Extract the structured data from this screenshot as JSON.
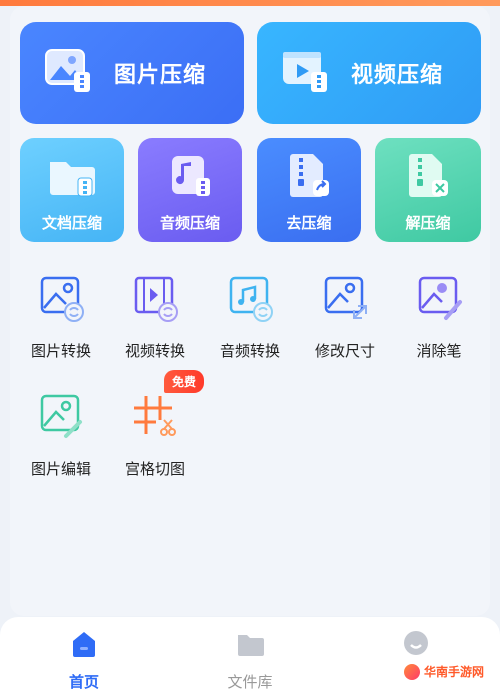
{
  "featured": {
    "image_compress": {
      "label": "图片压缩",
      "icon": "image-compress-icon"
    },
    "video_compress": {
      "label": "视频压缩",
      "icon": "video-compress-icon"
    }
  },
  "compress_tools": [
    {
      "label": "文档压缩",
      "icon": "folder-zip-icon"
    },
    {
      "label": "音频压缩",
      "icon": "music-zip-icon"
    },
    {
      "label": "去压缩",
      "icon": "zip-extract-icon"
    },
    {
      "label": "解压缩",
      "icon": "zip-unpack-icon"
    }
  ],
  "tools": [
    {
      "label": "图片转换",
      "icon": "image-convert-icon"
    },
    {
      "label": "视频转换",
      "icon": "video-convert-icon"
    },
    {
      "label": "音频转换",
      "icon": "audio-convert-icon"
    },
    {
      "label": "修改尺寸",
      "icon": "resize-icon"
    },
    {
      "label": "消除笔",
      "icon": "eraser-brush-icon"
    },
    {
      "label": "图片编辑",
      "icon": "image-edit-icon"
    },
    {
      "label": "宫格切图",
      "icon": "grid-cut-icon"
    }
  ],
  "badge": {
    "label": "免费"
  },
  "bottom_nav": [
    {
      "label": "首页",
      "active": true,
      "icon": "home-icon"
    },
    {
      "label": "文件库",
      "active": false,
      "icon": "folder-icon"
    },
    {
      "label": "我的",
      "active": false,
      "icon": "profile-icon"
    }
  ],
  "watermark": {
    "text": "华南手游网"
  },
  "colors": {
    "primary": "#2f6cf6",
    "tool_icon": "#3a6ef0",
    "badge": "#ff3a2a"
  }
}
